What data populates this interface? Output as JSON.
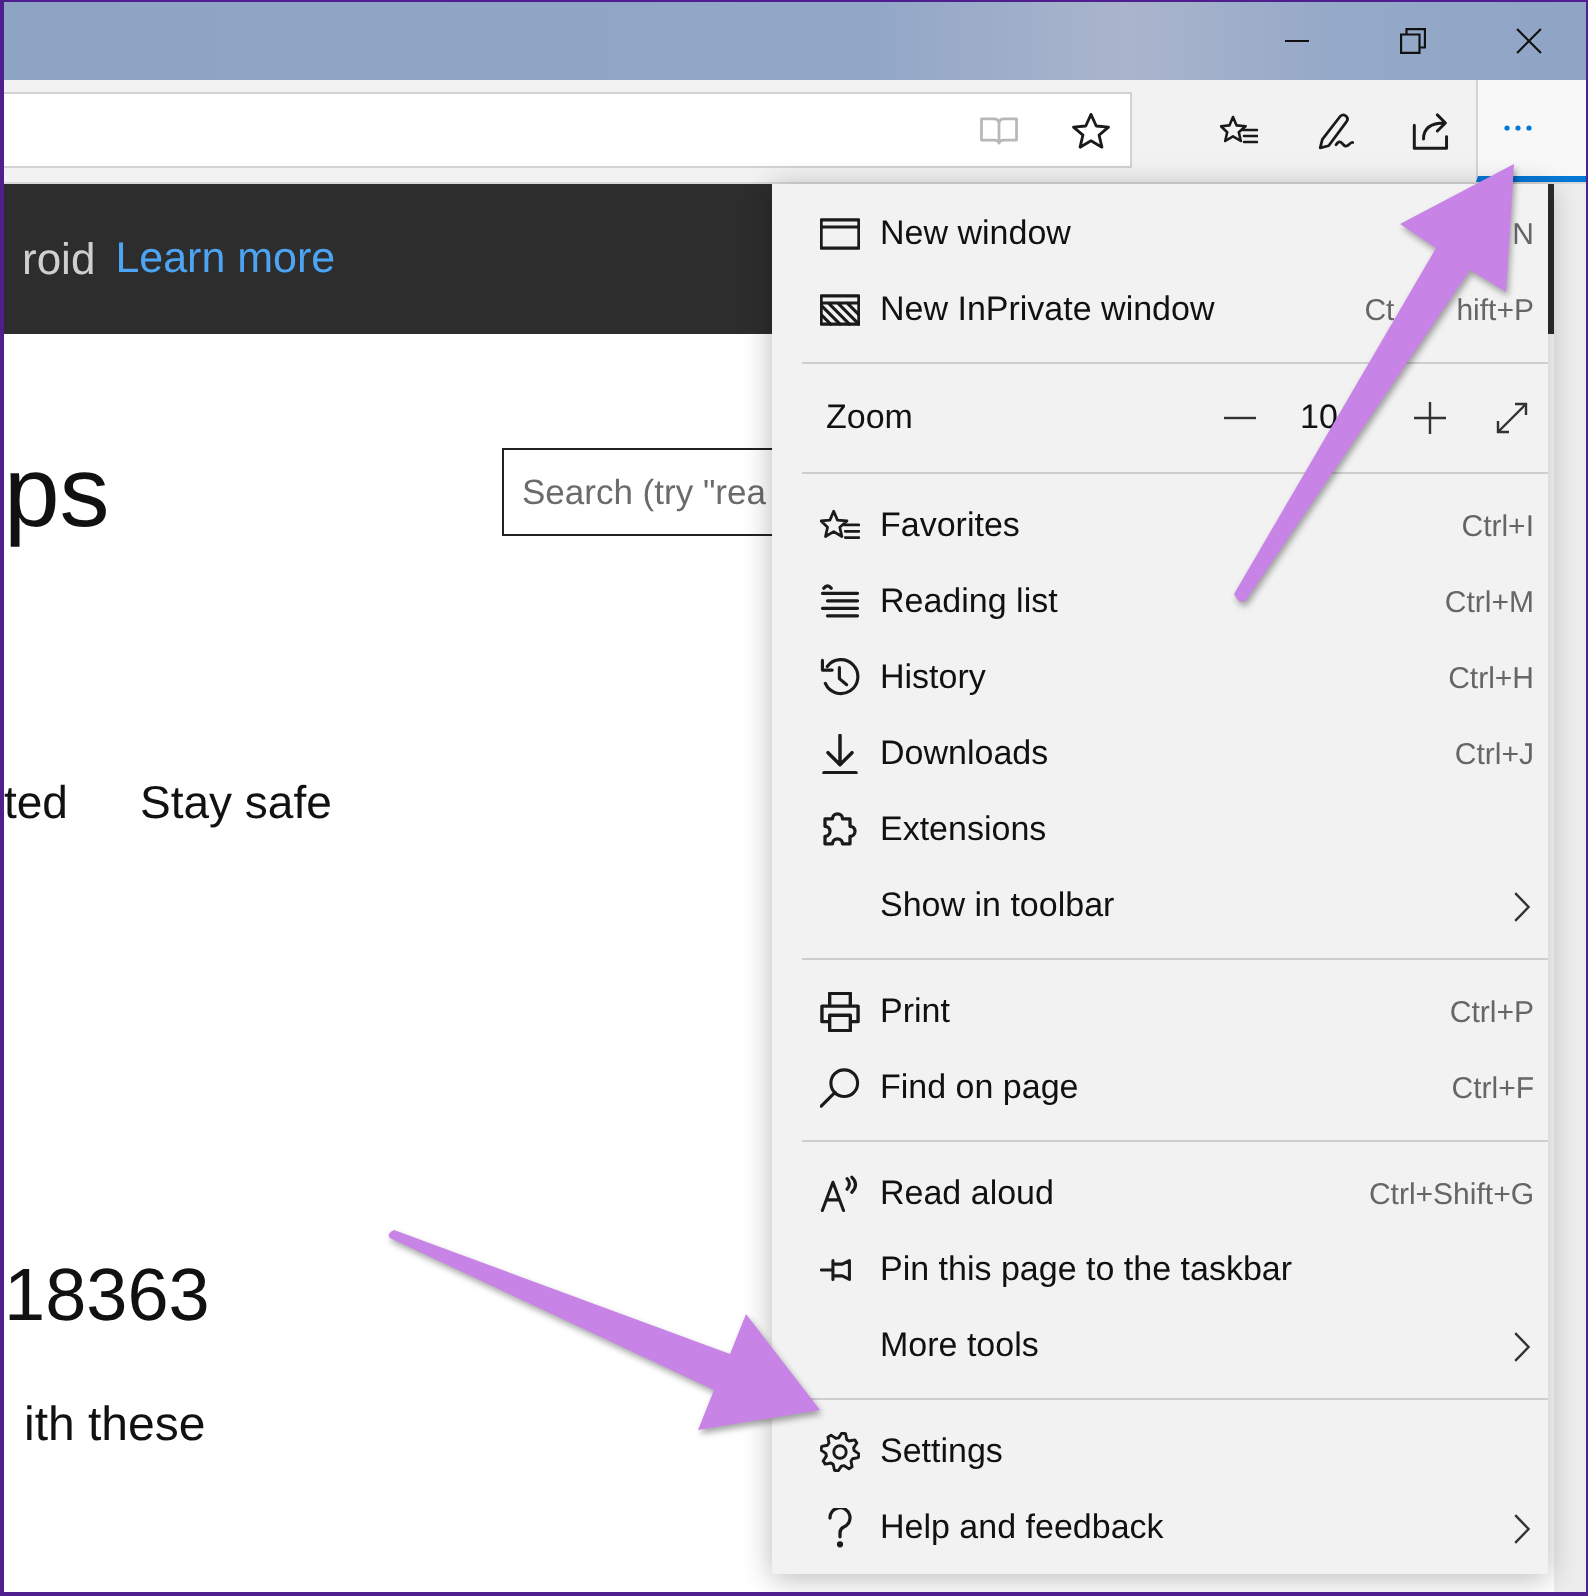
{
  "toolbar": {
    "reading_view": {
      "disabled": true
    },
    "more_button": {
      "expanded": true
    }
  },
  "page": {
    "banner": {
      "text": "roid",
      "link": "Learn more"
    },
    "heading": "ps",
    "search": {
      "placeholder": "Search (try \"rea"
    },
    "nav": [
      "ted",
      "Stay safe"
    ],
    "build": "18363",
    "subtitle": "ith these"
  },
  "menu": {
    "groups": [
      {
        "items": [
          {
            "kind": "item",
            "label": "New window",
            "shortcut": "N",
            "submenu": false
          },
          {
            "kind": "item",
            "label": "New InPrivate window",
            "shortcut_start": "Ct",
            "shortcut": "hift+P",
            "submenu": false
          }
        ]
      },
      {
        "items": [
          {
            "kind": "zoom",
            "label": "Zoom",
            "value": "10"
          }
        ]
      },
      {
        "items": [
          {
            "kind": "item",
            "label": "Favorites",
            "shortcut": "Ctrl+I",
            "submenu": false
          },
          {
            "kind": "item",
            "label": "Reading list",
            "shortcut": "Ctrl+M",
            "submenu": false
          },
          {
            "kind": "item",
            "label": "History",
            "shortcut": "Ctrl+H",
            "submenu": false
          },
          {
            "kind": "item",
            "label": "Downloads",
            "shortcut": "Ctrl+J",
            "submenu": false
          },
          {
            "kind": "item",
            "label": "Extensions",
            "submenu": false
          },
          {
            "kind": "item",
            "label": "Show in toolbar",
            "submenu": true
          }
        ]
      },
      {
        "items": [
          {
            "kind": "item",
            "label": "Print",
            "shortcut": "Ctrl+P",
            "submenu": false
          },
          {
            "kind": "item",
            "label": "Find on page",
            "shortcut": "Ctrl+F",
            "submenu": false
          }
        ]
      },
      {
        "items": [
          {
            "kind": "item",
            "label": "Read aloud",
            "shortcut": "Ctrl+Shift+G",
            "submenu": false
          },
          {
            "kind": "item",
            "label": "Pin this page to the taskbar",
            "submenu": false
          },
          {
            "kind": "item",
            "label": "More tools",
            "submenu": true
          }
        ]
      },
      {
        "items": [
          {
            "kind": "item",
            "label": "Settings",
            "submenu": false
          },
          {
            "kind": "item",
            "label": "Help and feedback",
            "submenu": true
          }
        ]
      }
    ]
  }
}
